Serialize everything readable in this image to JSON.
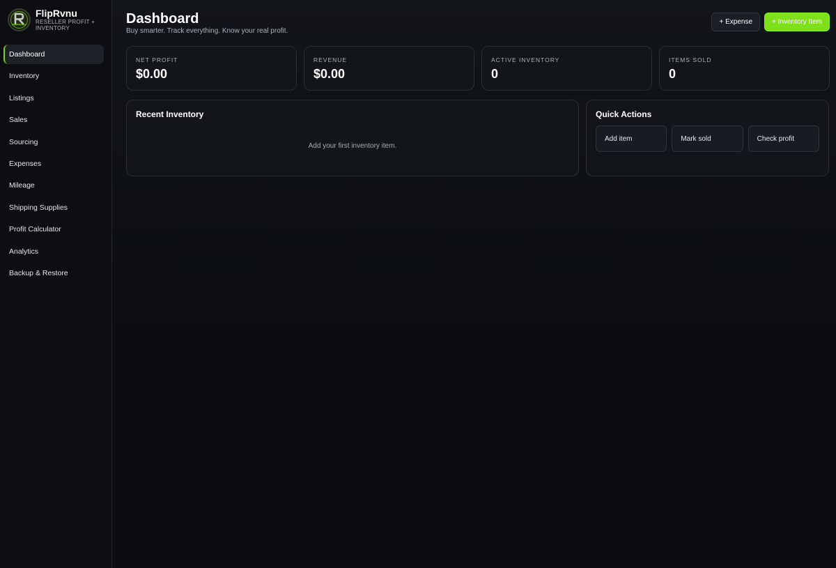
{
  "brand": {
    "name": "FlipRvnu",
    "tagline": "RESELLER PROFIT + INVENTORY",
    "logo_text": "FLIPRVNU",
    "accent": "#7ee01a"
  },
  "sidebar": {
    "items": [
      {
        "label": "Dashboard",
        "active": true
      },
      {
        "label": "Inventory"
      },
      {
        "label": "Listings"
      },
      {
        "label": "Sales"
      },
      {
        "label": "Sourcing"
      },
      {
        "label": "Expenses"
      },
      {
        "label": "Mileage"
      },
      {
        "label": "Shipping Supplies"
      },
      {
        "label": "Profit Calculator"
      },
      {
        "label": "Analytics"
      },
      {
        "label": "Backup & Restore"
      }
    ]
  },
  "header": {
    "title": "Dashboard",
    "subtitle": "Buy smarter. Track everything. Know your real profit.",
    "expense_button": "+ Expense",
    "inventory_button": "+ Inventory Item"
  },
  "stats": [
    {
      "label": "NET PROFIT",
      "value": "$0.00"
    },
    {
      "label": "REVENUE",
      "value": "$0.00"
    },
    {
      "label": "ACTIVE INVENTORY",
      "value": "0"
    },
    {
      "label": "ITEMS SOLD",
      "value": "0"
    }
  ],
  "recent_inventory": {
    "title": "Recent Inventory",
    "empty_text": "Add your first inventory item."
  },
  "quick_actions": {
    "title": "Quick Actions",
    "items": [
      "Add item",
      "Mark sold",
      "Check profit"
    ]
  }
}
